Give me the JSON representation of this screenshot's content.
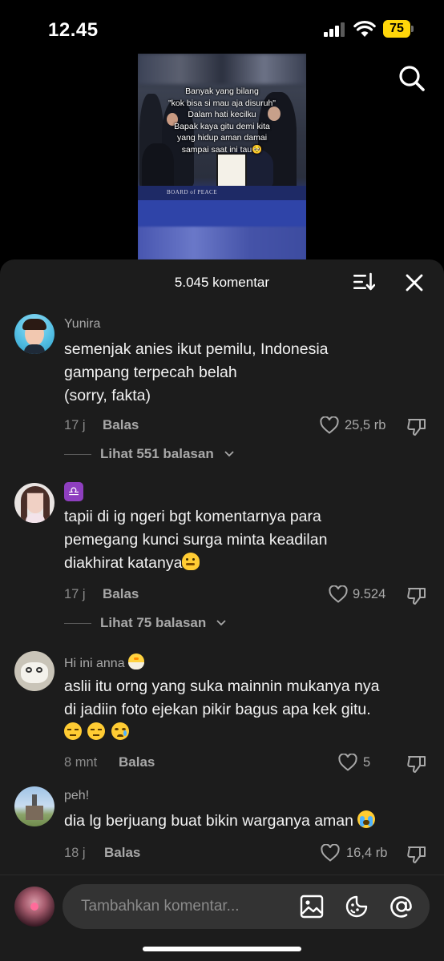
{
  "status_bar": {
    "time": "12.45",
    "battery": "75"
  },
  "video": {
    "caption": [
      "Banyak yang bilang",
      "\"kok bisa si mau aja disuruh\"",
      "Dalam hati kecilku",
      "Bapak kaya gitu demi kita",
      "yang hidup aman damai",
      "sampai saat ini tau🥺"
    ],
    "banner": "BOARD of PEACE"
  },
  "sheet": {
    "title": "5.045 komentar"
  },
  "comments": [
    {
      "username": "Yunira",
      "lines": [
        "semenjak anies ikut pemilu, Indonesia",
        "gampang terpecah belah",
        "(sorry, fakta)"
      ],
      "time": "17 j",
      "reply_label": "Balas",
      "likes": "25,5 rb",
      "view_replies": "Lihat 551 balasan"
    },
    {
      "username": "♎",
      "lines": [
        "tapii di ig ngeri bgt komentarnya para",
        "pemegang kunci surga minta keadilan",
        "diakhirat katanya"
      ],
      "time": "17 j",
      "reply_label": "Balas",
      "likes": "9.524",
      "view_replies": "Lihat 75 balasan"
    },
    {
      "username": "Hi ini anna",
      "lines": [
        "aslii itu orng yang suka mainnin mukanya nya",
        "di jadiin foto ejekan pikir bagus apa kek gitu."
      ],
      "time": "8 mnt",
      "reply_label": "Balas",
      "likes": "5"
    },
    {
      "username": "peh!",
      "lines": [
        "dia lg berjuang buat bikin warganya aman"
      ],
      "time": "18 j",
      "reply_label": "Balas",
      "likes": "16,4 rb"
    }
  ],
  "input": {
    "placeholder": "Tambahkan komentar..."
  },
  "colors": {
    "sheet_bg": "#1c1c1c",
    "battery": "#ffd60a",
    "muted_text": "#a8a8a8"
  }
}
